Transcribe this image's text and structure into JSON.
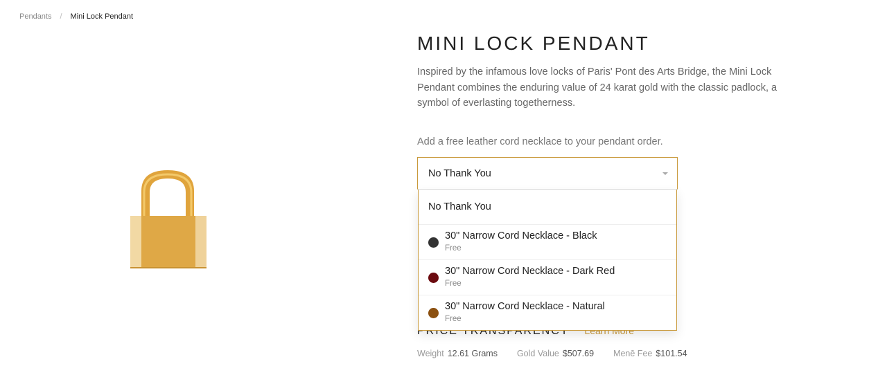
{
  "breadcrumb": {
    "parent": "Pendants",
    "separator": "/",
    "current": "Mini Lock Pendant"
  },
  "product": {
    "title": "MINI LOCK PENDANT",
    "description": "Inspired by the infamous love locks of Paris' Pont des Arts Bridge, the Mini Lock Pendant combines the enduring value of 24 karat gold with the classic padlock, a symbol of everlasting togetherness.",
    "image_icon": "gold-padlock-image"
  },
  "cord_select": {
    "prompt": "Add a free leather cord necklace to your pendant order.",
    "selected": "No Thank You",
    "options": [
      {
        "label": "No Thank You",
        "sub": ""
      },
      {
        "label": "30\" Narrow Cord Necklace - Black",
        "sub": "Free",
        "color": "#333333"
      },
      {
        "label": "30\" Narrow Cord Necklace - Dark Red",
        "sub": "Free",
        "color": "#6b0a0f"
      },
      {
        "label": "30\" Narrow Cord Necklace - Natural",
        "sub": "Free",
        "color": "#8b5010"
      }
    ]
  },
  "price": {
    "title": "PRICE TRANSPARENCY",
    "learn_more": "Learn More",
    "weight_label": "Weight",
    "weight_value": "12.61 Grams",
    "gold_label": "Gold Value",
    "gold_value": "$507.69",
    "fee_label": "Menē Fee",
    "fee_value": "$101.54"
  },
  "colors": {
    "accent": "#c99a3c",
    "gold": "#e2aa45"
  }
}
